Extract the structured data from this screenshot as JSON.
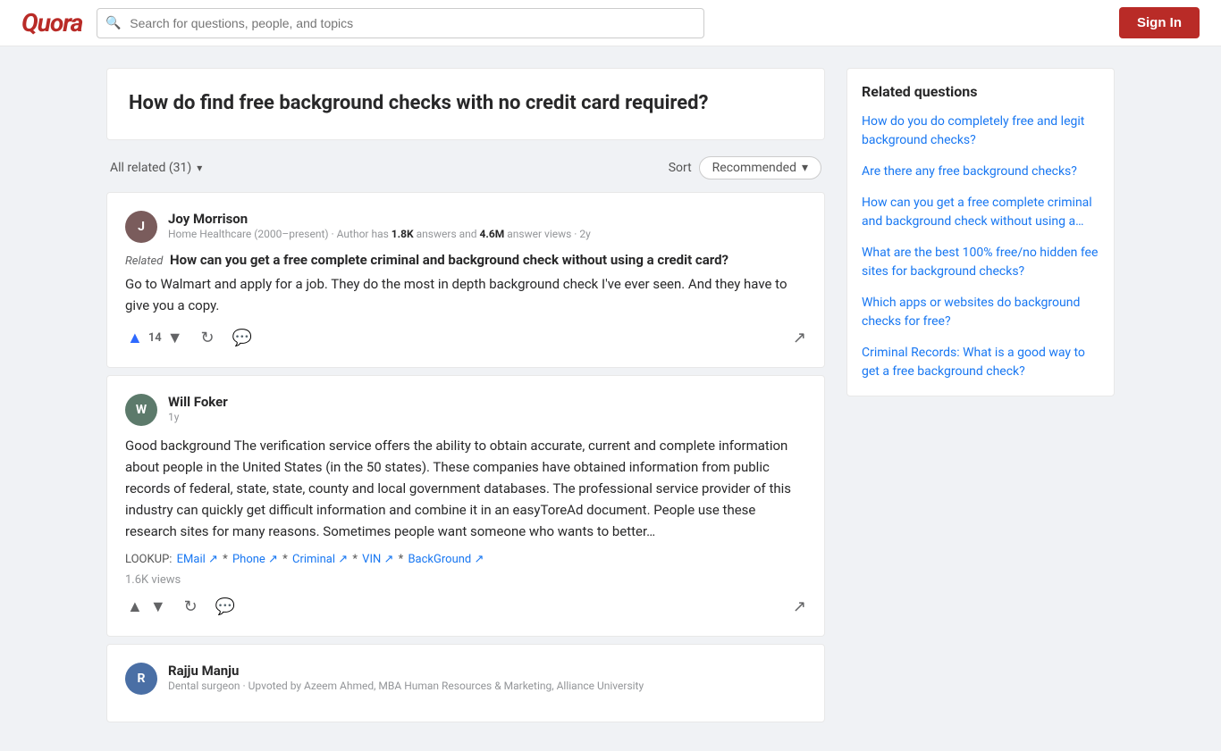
{
  "header": {
    "logo": "Quora",
    "search_placeholder": "Search for questions, people, and topics",
    "sign_in_label": "Sign In"
  },
  "question": {
    "title": "How do find free background checks with no credit card required?"
  },
  "answers_controls": {
    "all_related_label": "All related (31)",
    "sort_label": "Sort",
    "recommended_label": "Recommended",
    "chevron": "▾"
  },
  "answers": [
    {
      "id": "joy-morrison",
      "author": "Joy Morrison",
      "meta": "Home Healthcare (2000–present) · Author has ",
      "answers_count": "1.8K",
      "meta_mid": " answers and ",
      "views_count": "4.6M",
      "meta_end": " answer views · 2y",
      "related_label": "Related",
      "related_question": "How can you get a free complete criminal and background check without using a credit card?",
      "answer_text": "Go to Walmart and apply for a job. They do the most in depth background check I've ever seen. And they have to give you a copy.",
      "upvotes": "14",
      "has_related_tag": true,
      "has_lookup": false,
      "views": null,
      "initials": "J"
    },
    {
      "id": "will-foker",
      "author": "Will Foker",
      "meta": "1y",
      "answers_count": null,
      "meta_mid": null,
      "views_count": null,
      "meta_end": null,
      "related_label": null,
      "related_question": null,
      "answer_text": "Good background The verification service offers the ability to obtain accurate, current and complete information about people in the United States (in the 50 states). These companies have obtained information from public records of federal, state, state, county and local government databases. The professional service provider of this industry can quickly get difficult information and combine it in an easyToreAd document. People use these research sites for many reasons. Sometimes people want someone who wants to better…",
      "upvotes": null,
      "has_related_tag": false,
      "has_lookup": true,
      "lookup_text": "LOOKUP: EMail ↗ * Phone ↗ * Criminal ↗ * VIN ↗ * BackGround ↗",
      "views": "1.6K views",
      "initials": "W"
    },
    {
      "id": "rajju-manju",
      "author": "Rajju Manju",
      "meta": "Dental surgeon · Upvoted by Azeem Ahmed, MBA Human Resources & Marketing, Alliance University",
      "initials": "R"
    }
  ],
  "related_questions": {
    "title": "Related questions",
    "items": [
      "How do you do completely free and legit background checks?",
      "Are there any free background checks?",
      "How can you get a free complete criminal and background check without using a…",
      "What are the best 100% free/no hidden fee sites for background checks?",
      "Which apps or websites do background checks for free?",
      "Criminal Records: What is a good way to get a free background check?"
    ]
  }
}
